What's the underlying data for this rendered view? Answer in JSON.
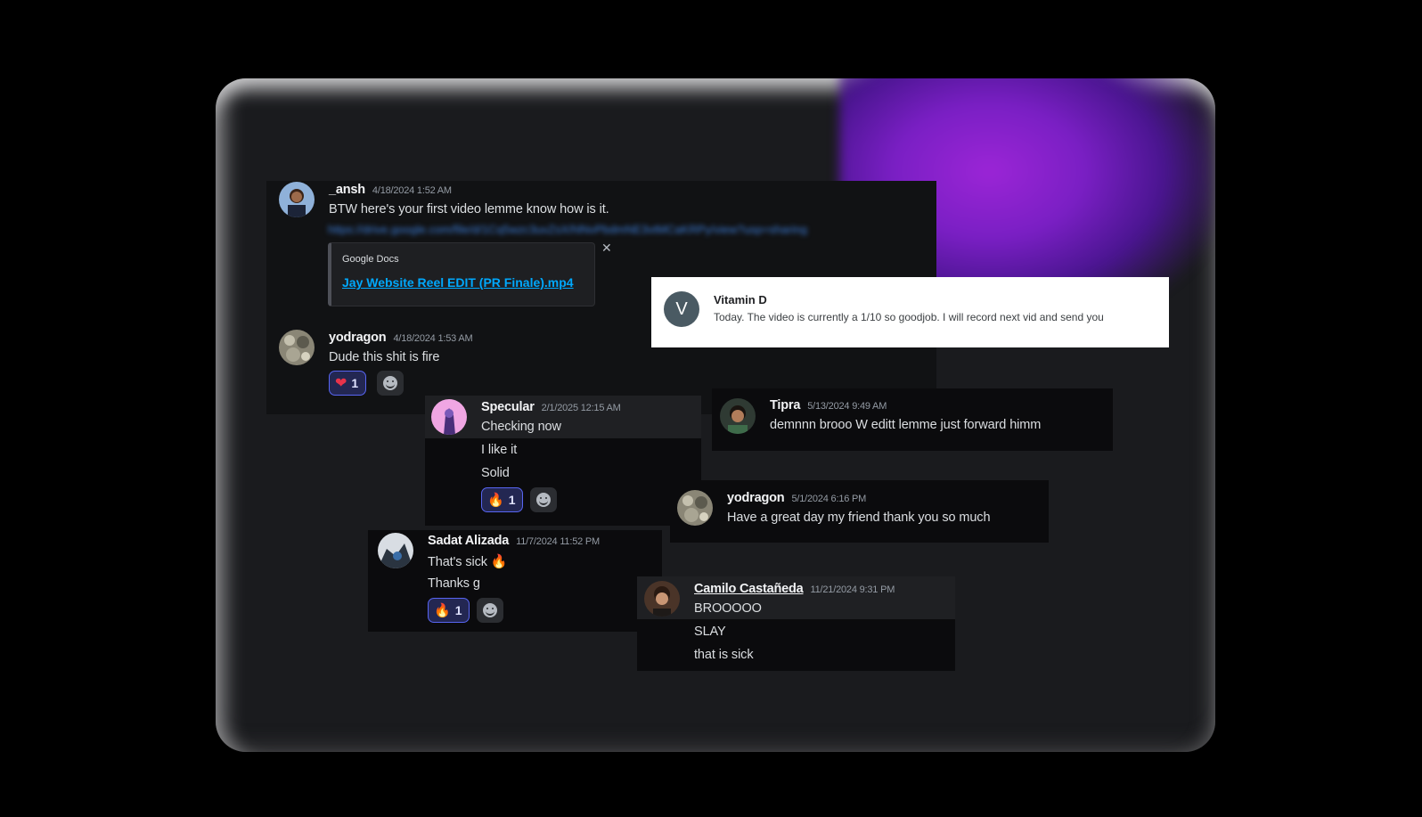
{
  "messages": [
    {
      "user": "_ansh",
      "time": "4/18/2024 1:52 AM",
      "lines": [
        "BTW here's your first video lemme know how is it."
      ],
      "link": "https://drive.google.com/file/d/1Cq5wzc3uvZsX/hlNvPbdmNE3vtMCaKRPy/view?usp=sharing"
    },
    {
      "user": "yodragon",
      "time": "4/18/2024 1:53 AM",
      "lines": [
        "Dude this shit is fire"
      ],
      "reaction": {
        "emoji": "heart",
        "count": "1"
      }
    },
    {
      "user": "Specular",
      "time": "2/1/2025 12:15 AM",
      "lines": [
        "Checking now",
        "I like it",
        "Solid"
      ],
      "reaction": {
        "emoji": "fire",
        "count": "1"
      }
    },
    {
      "user": "Tipra",
      "time": "5/13/2024 9:49 AM",
      "lines": [
        "demnnn brooo W editt lemme just forward himm"
      ]
    },
    {
      "user": "yodragon",
      "time": "5/1/2024 6:16 PM",
      "lines": [
        "Have a great day my friend thank you so much"
      ]
    },
    {
      "user": "Sadat Alizada",
      "time": "11/7/2024 11:52 PM",
      "lines": [
        "That's sick",
        "Thanks g"
      ],
      "reaction": {
        "emoji": "fire",
        "count": "1"
      }
    },
    {
      "user": "Camilo Castañeda",
      "time": "11/21/2024 9:31 PM",
      "lines": [
        "BROOOOO",
        "SLAY",
        "that is sick"
      ]
    }
  ],
  "embed": {
    "provider": "Google Docs",
    "title": "Jay Website Reel EDIT (PR Finale).mp4"
  },
  "notification": {
    "avatar_letter": "V",
    "name": "Vitamin D",
    "text": "Today. The video is currently a 1/10 so goodjob. I will record next vid and send you"
  },
  "colors": {
    "accent": "#5865f2",
    "glow": "#9b25d6",
    "link": "#00a8fc"
  }
}
